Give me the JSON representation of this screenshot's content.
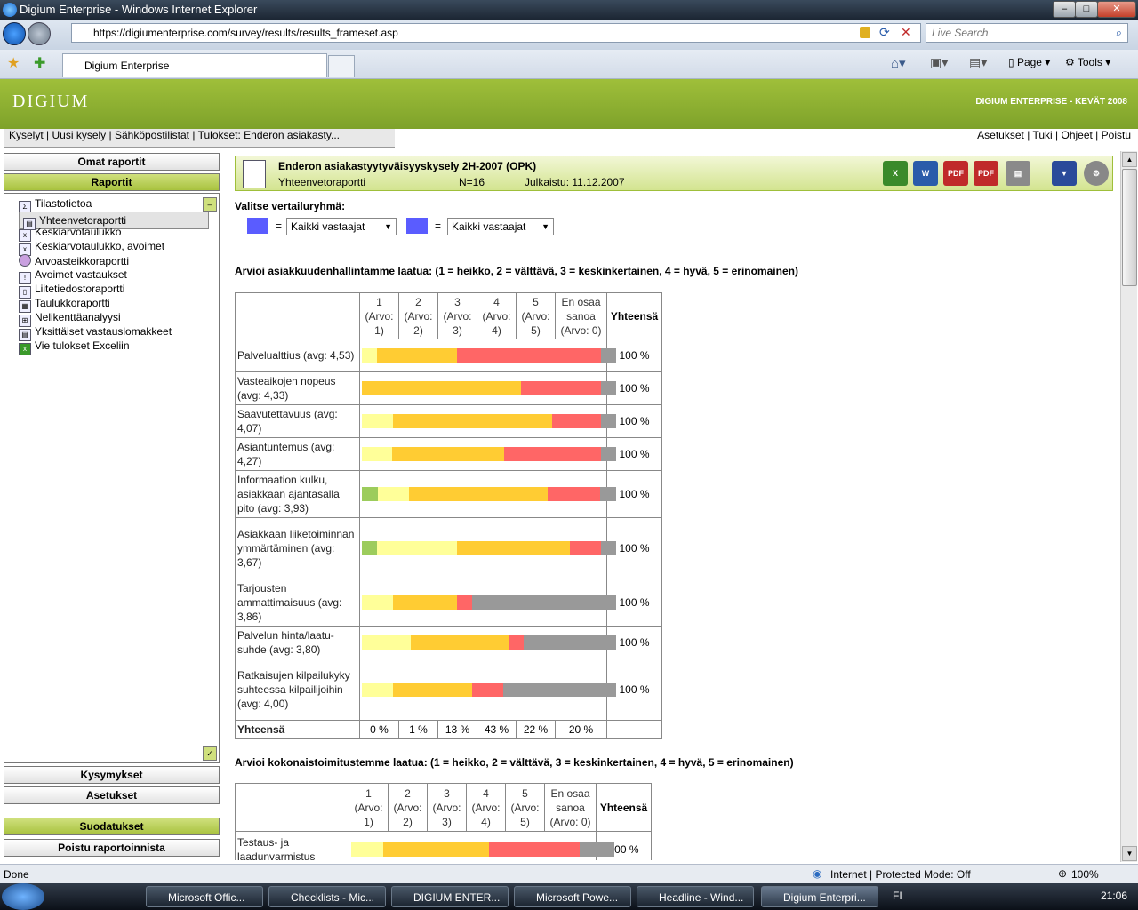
{
  "window": {
    "title": "Digium Enterprise - Windows Internet Explorer"
  },
  "browser": {
    "url": "https://digiumenterprise.com/survey/results/results_frameset.asp",
    "search_placeholder": "Live Search",
    "tab_title": "Digium Enterprise",
    "page_label": "Page",
    "tools_label": "Tools"
  },
  "header": {
    "logo": "DIGIUM",
    "brand": "DIGIUM ENTERPRISE - KEVÄT 2008",
    "nav_left": [
      "Kyselyt",
      "Uusi kysely",
      "Sähköpostilistat",
      "Tulokset: Enderon asiakasty..."
    ],
    "nav_right": [
      "Asetukset",
      "Tuki",
      "Ohjeet",
      "Poistu"
    ]
  },
  "sidebar": {
    "omat": "Omat raportit",
    "raportit": "Raportit",
    "items": [
      "Tilastotietoa",
      "Yhteenvetoraportti",
      "Keskiarvotaulukko",
      "Keskiarvotaulukko, avoimet",
      "Arvoasteikkoraportti",
      "Avoimet vastaukset",
      "Liitetiedostoraportti",
      "Taulukkoraportti",
      "Nelikenttäanalyysi",
      "Yksittäiset vastauslomakkeet",
      "Vie tulokset Exceliin"
    ],
    "kysymykset": "Kysymykset",
    "asetukset": "Asetukset",
    "suodatukset": "Suodatukset",
    "poistu": "Poistu raportoinnista"
  },
  "report": {
    "title": "Enderon asiakastyytyväisyyskysely 2H-2007 (OPK)",
    "subtitle": "Yhteenvetoraportti",
    "n": "N=16",
    "published": "Julkaistu: 11.12.2007",
    "compare_label": "Valitse vertailuryhmä:",
    "group1": "Kaikki vastaajat",
    "group2": "Kaikki vastaajat",
    "equals": "="
  },
  "colors": {
    "c1": "#9ccc5c",
    "c2": "#ffff99",
    "c3": "#ffcc33",
    "c4": "#ff6666",
    "c5": "#999999",
    "swatch": "#5a5cff",
    "accent": "#9fbf3a"
  },
  "q1": {
    "title": "Arvioi asiakkuudenhallintamme laatua: (1 = heikko, 2 = välttävä, 3 = keskinkertainen, 4 = hyvä, 5 = erinomainen)",
    "headers": [
      "1 (Arvo: 1)",
      "2 (Arvo: 2)",
      "3 (Arvo: 3)",
      "4 (Arvo: 4)",
      "5 (Arvo: 5)",
      "En osaa sanoa (Arvo: 0)"
    ],
    "total_header": "Yhteensä",
    "rows": [
      {
        "label": "Palvelualttius (avg: 4,53)",
        "pct": "100 %",
        "dist": [
          0,
          6,
          31,
          56,
          0,
          6
        ]
      },
      {
        "label": "Vasteaikojen nopeus (avg: 4,33)",
        "pct": "100 %",
        "dist": [
          0,
          0,
          62,
          31,
          0,
          6
        ]
      },
      {
        "label": "Saavutettavuus (avg: 4,07)",
        "pct": "100 %",
        "dist": [
          0,
          12,
          62,
          19,
          0,
          6
        ]
      },
      {
        "label": "Asiantuntemus (avg: 4,27)",
        "pct": "100 %",
        "dist": [
          0,
          12,
          44,
          38,
          0,
          6
        ]
      },
      {
        "label": "Informaation kulku, asiakkaan ajantasalla pito (avg: 3,93)",
        "pct": "100 %",
        "dist": [
          6,
          12,
          53,
          20,
          0,
          6
        ]
      },
      {
        "label": "Asiakkaan liiketoiminnan ymmärtäminen (avg: 3,67)",
        "pct": "100 %",
        "dist": [
          6,
          31,
          44,
          12,
          0,
          6
        ]
      },
      {
        "label": "Tarjousten ammattimaisuus (avg: 3,86)",
        "pct": "100 %",
        "dist": [
          0,
          12,
          25,
          6,
          0,
          56
        ]
      },
      {
        "label": "Palvelun hinta/laatu-suhde (avg: 3,80)",
        "pct": "100 %",
        "dist": [
          0,
          19,
          38,
          6,
          0,
          36
        ]
      },
      {
        "label": "Ratkaisujen kilpailukyky suhteessa kilpailijoihin (avg: 4,00)",
        "pct": "100 %",
        "dist": [
          0,
          12,
          31,
          12,
          0,
          44
        ]
      }
    ],
    "total_label": "Yhteensä",
    "totals": [
      "0 %",
      "1 %",
      "13 %",
      "43 %",
      "22 %",
      "20 %"
    ]
  },
  "q2": {
    "title": "Arvioi kokonaistoimitustemme laatua: (1 = heikko, 2 = välttävä, 3 = keskinkertainen, 4 = hyvä, 5 = erinomainen)",
    "headers": [
      "1 (Arvo: 1)",
      "2 (Arvo: 2)",
      "3 (Arvo: 3)",
      "4 (Arvo: 4)",
      "5 (Arvo: 5)",
      "En osaa sanoa (Arvo: 0)"
    ],
    "total_header": "Yhteensä",
    "rows": [
      {
        "label": "Testaus- ja laadunvarmistus",
        "pct": "100 %",
        "dist": [
          0,
          12,
          40,
          34,
          0,
          13
        ]
      }
    ]
  },
  "status": {
    "left": "Done",
    "zone": "Internet | Protected Mode: Off",
    "zoom": "100%"
  },
  "taskbar": {
    "items": [
      "Microsoft Offic...",
      "Checklists - Mic...",
      "DIGIUM ENTER...",
      "Microsoft Powe...",
      "Headline - Wind...",
      "Digium Enterpri..."
    ],
    "lang": "FI",
    "clock": "21:06"
  }
}
